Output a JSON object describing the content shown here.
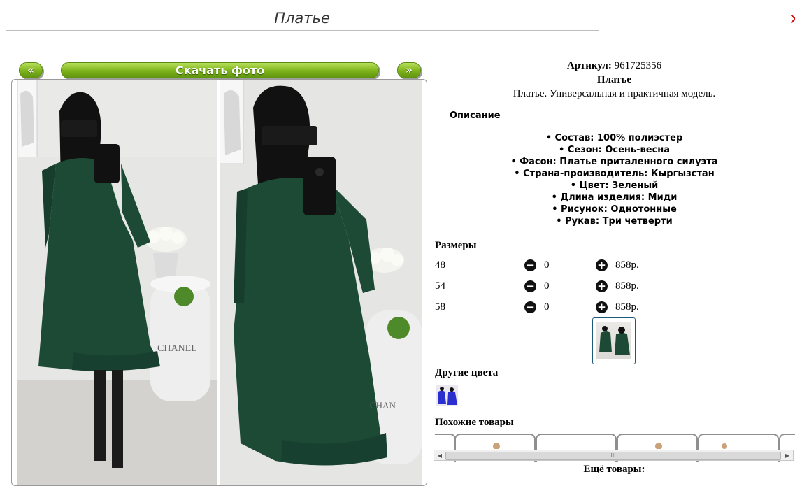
{
  "page": {
    "title": "Платье"
  },
  "nav": {
    "prev_label": "«",
    "next_label": "»",
    "download_label": "Скачать фото"
  },
  "product": {
    "article_label": "Артикул:",
    "article_value": "961725356",
    "name": "Платье",
    "short_desc": "Платье. Универсальная и практичная модель.",
    "description_heading": "Описание",
    "specs": [
      "• Состав: 100% полиэстер",
      "• Сезон: Осень-весна",
      "• Фасон: Платье приталенного силуэта",
      "• Страна-производитель: Кыргызстан",
      "• Цвет: Зеленый",
      "• Длина изделия: Миди",
      "• Рисунок: Однотонные",
      "• Рукав: Три четверти"
    ]
  },
  "sizes": {
    "heading": "Размеры",
    "rows": [
      {
        "size": "48",
        "qty": "0",
        "price": "858р."
      },
      {
        "size": "54",
        "qty": "0",
        "price": "858р."
      },
      {
        "size": "58",
        "qty": "0",
        "price": "858р."
      }
    ]
  },
  "other_colors": {
    "heading": "Другие цвета"
  },
  "similar": {
    "heading": "Похожие товары",
    "more_label": "Ещё товары:",
    "scroll_thumb_label": "III"
  },
  "icons": {
    "minus": "minus-circle-icon",
    "plus": "plus-circle-icon",
    "close": "close-icon"
  },
  "colors": {
    "button_green": "#7cb219",
    "dress_green": "#1d4a35",
    "selected_border": "#1b5b7a"
  }
}
